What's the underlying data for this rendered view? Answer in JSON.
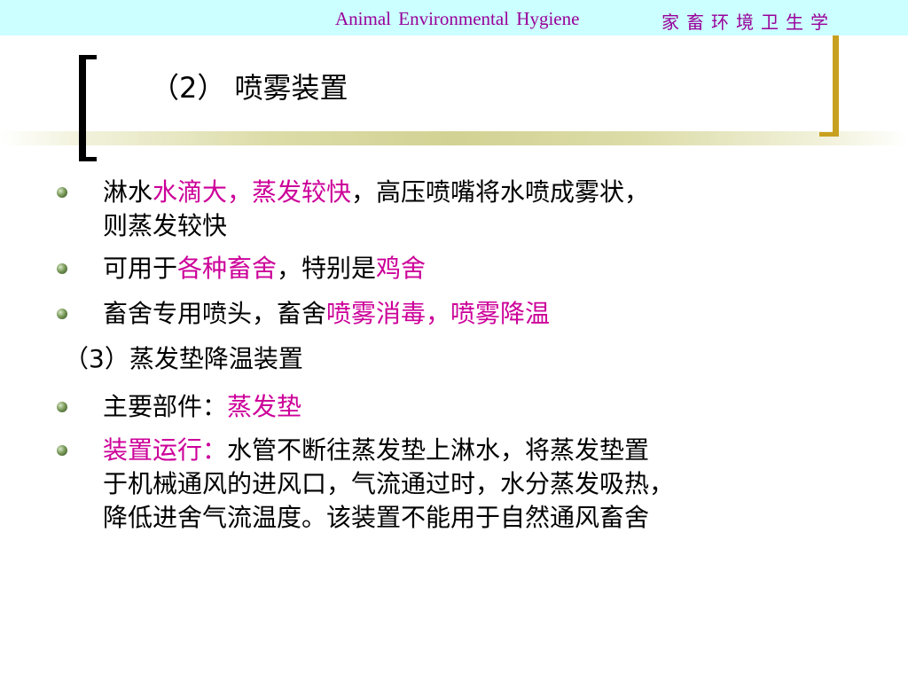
{
  "header": {
    "course_en": "Animal  Environmental  Hygiene",
    "course_cn": "家畜环境卫生学"
  },
  "slide": {
    "title": "（2） 喷雾装置",
    "bullets": [
      {
        "parts": [
          "淋水",
          "水滴大，蒸发较快",
          "，高压喷嘴将水喷成雾状，"
        ],
        "line2": "则蒸发较快"
      },
      {
        "parts": [
          "可用于",
          "各种畜舍",
          "，特别是",
          "鸡舍"
        ]
      },
      {
        "parts": [
          "畜舍专用喷头，畜舍",
          "喷雾消毒，喷雾降温"
        ]
      }
    ],
    "section2_heading": "（3）蒸发垫降温装置",
    "bullets2": [
      {
        "parts": [
          "主要部件：",
          "蒸发垫"
        ]
      },
      {
        "parts": [
          "装置运行：",
          "水管不断往蒸发垫上淋水，将蒸发垫置"
        ],
        "line2": "于机械通风的进风口，气流通过时，水分蒸发吸热，",
        "line3": "降低进舍气流温度。该装置不能用于自然通风畜舍"
      }
    ]
  },
  "colors": {
    "header_background": "#ccffff",
    "header_text": "#990099",
    "highlight": "#cc0099",
    "right_bracket": "#c8a020"
  }
}
